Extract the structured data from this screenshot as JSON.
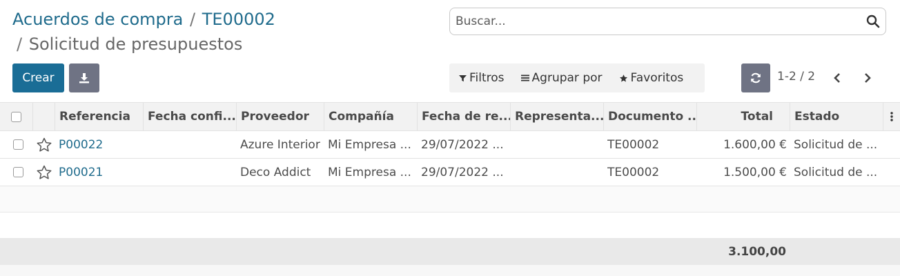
{
  "breadcrumb": {
    "item1": "Acuerdos de compra",
    "sep1": "/",
    "item2": "TE00002",
    "sep2": "/",
    "current": "Solicitud de presupuestos"
  },
  "search": {
    "placeholder": "Buscar..."
  },
  "actions": {
    "create_label": "Crear"
  },
  "filters": {
    "filters_label": "Filtros",
    "groupby_label": "Agrupar por",
    "favorites_label": "Favoritos"
  },
  "pager": {
    "text": "1-2 / 2"
  },
  "table": {
    "columns": {
      "reference": "Referencia",
      "confirm_date": "Fecha confi...",
      "vendor": "Proveedor",
      "company": "Compañía",
      "receipt_date": "Fecha de re...",
      "representative": "Representa...",
      "source_doc": "Documento ...",
      "total": "Total",
      "status": "Estado"
    },
    "rows": [
      {
        "reference": "P00022",
        "confirm_date": "",
        "vendor": "Azure Interior",
        "company": "Mi Empresa ...",
        "receipt_date": "29/07/2022 ...",
        "representative": "",
        "source_doc": "TE00002",
        "total": "1.600,00 €",
        "status": "Solicitud de ..."
      },
      {
        "reference": "P00021",
        "confirm_date": "",
        "vendor": "Deco Addict",
        "company": "Mi Empresa ...",
        "receipt_date": "29/07/2022 ...",
        "representative": "",
        "source_doc": "TE00002",
        "total": "1.500,00 €",
        "status": "Solicitud de ..."
      }
    ],
    "sum_total": "3.100,00"
  },
  "colors": {
    "primary": "#1a6d96",
    "link": "#1f6b8c",
    "secondary": "#6f7384"
  }
}
